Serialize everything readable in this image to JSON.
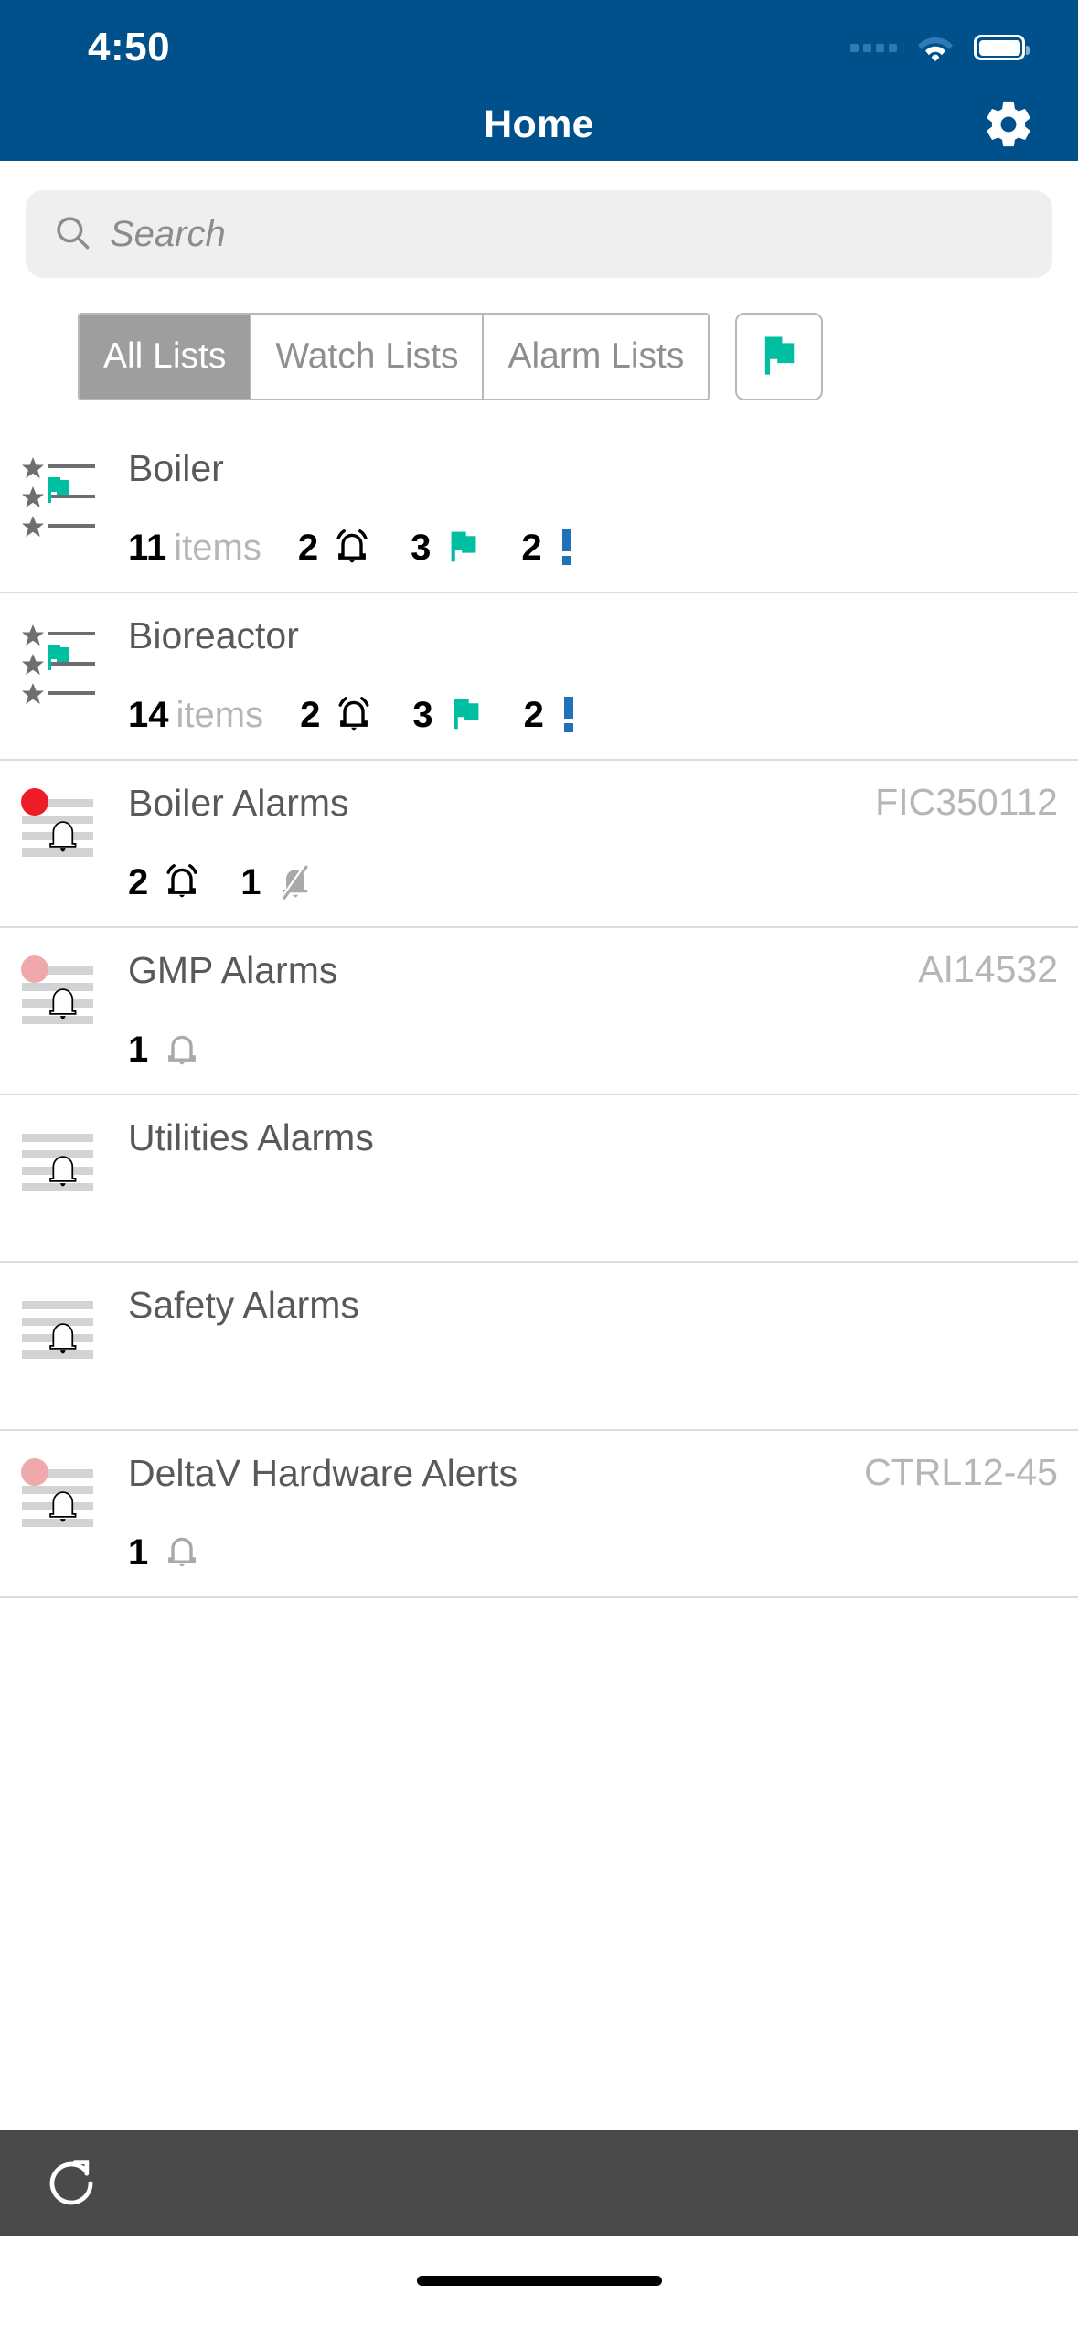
{
  "statusbar": {
    "time": "4:50",
    "cellular_icon": "cellular-dots-icon",
    "wifi_icon": "wifi-icon",
    "battery_icon": "battery-icon"
  },
  "header": {
    "title": "Home",
    "settings_icon": "gear-icon",
    "background_color": "#00508C"
  },
  "search": {
    "placeholder": "Search",
    "icon": "search-icon",
    "value": ""
  },
  "segmented": {
    "options": [
      {
        "label": "All Lists",
        "active": true
      },
      {
        "label": "Watch Lists",
        "active": false
      },
      {
        "label": "Alarm Lists",
        "active": false
      }
    ],
    "flag_filter_icon": "flag-icon",
    "active_background": "#9e9e9e"
  },
  "colors": {
    "flag_teal": "#00BFA0",
    "alarm_red": "#EE1C25",
    "alarm_pink": "#EFA9AC",
    "info_blue": "#1F72B8",
    "header_blue": "#00508C",
    "toolbar_gray": "#4a4a4a"
  },
  "lists": [
    {
      "name": "Boiler",
      "tag": "",
      "icon": "watch-list-icon",
      "status_dot": "",
      "badges": [
        {
          "count": "11",
          "unit": "items",
          "icon": ""
        },
        {
          "count": "2",
          "unit": "",
          "icon": "alarm-bell-icon"
        },
        {
          "count": "3",
          "unit": "",
          "icon": "flag-icon"
        },
        {
          "count": "2",
          "unit": "",
          "icon": "exclamation-icon"
        }
      ]
    },
    {
      "name": "Bioreactor",
      "tag": "",
      "icon": "watch-list-icon",
      "status_dot": "",
      "badges": [
        {
          "count": "14",
          "unit": "items",
          "icon": ""
        },
        {
          "count": "2",
          "unit": "",
          "icon": "alarm-bell-icon"
        },
        {
          "count": "3",
          "unit": "",
          "icon": "flag-icon"
        },
        {
          "count": "2",
          "unit": "",
          "icon": "exclamation-icon"
        }
      ]
    },
    {
      "name": "Boiler Alarms",
      "tag": "FIC350112",
      "icon": "alarm-list-icon",
      "status_dot": "red",
      "badges": [
        {
          "count": "2",
          "unit": "",
          "icon": "alarm-bell-icon"
        },
        {
          "count": "1",
          "unit": "",
          "icon": "bell-muted-icon"
        }
      ]
    },
    {
      "name": "GMP Alarms",
      "tag": "AI14532",
      "icon": "alarm-list-icon",
      "status_dot": "pink",
      "badges": [
        {
          "count": "1",
          "unit": "",
          "icon": "bell-outline-icon"
        }
      ]
    },
    {
      "name": "Utilities Alarms",
      "tag": "",
      "icon": "alarm-list-icon",
      "status_dot": "",
      "badges": []
    },
    {
      "name": "Safety Alarms",
      "tag": "",
      "icon": "alarm-list-icon",
      "status_dot": "",
      "badges": []
    },
    {
      "name": "DeltaV Hardware Alerts",
      "tag": "CTRL12-45",
      "icon": "alarm-list-icon",
      "status_dot": "pink",
      "badges": [
        {
          "count": "1",
          "unit": "",
          "icon": "bell-outline-icon"
        }
      ]
    }
  ],
  "toolbar": {
    "refresh_icon": "refresh-icon"
  }
}
